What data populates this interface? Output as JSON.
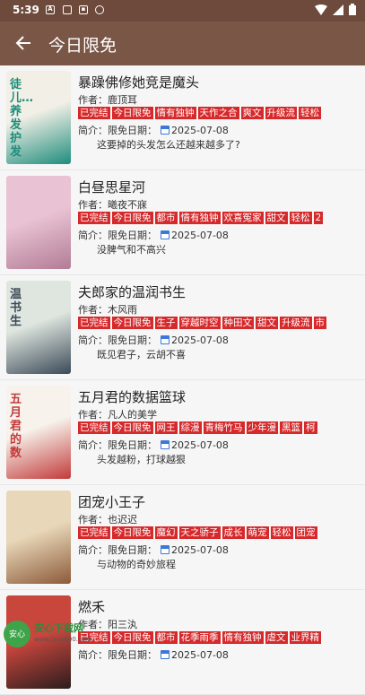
{
  "status_bar": {
    "time": "5:39"
  },
  "app_bar": {
    "title": "今日限免"
  },
  "labels": {
    "author_prefix": "作者：",
    "intro_prefix": "简介：",
    "date_prefix": "限免日期："
  },
  "books": [
    {
      "title": "暴躁佛修她竞是魔头",
      "author": "鹿顶耳",
      "tags": [
        "已完结",
        "今日限免",
        "情有独钟",
        "天作之合",
        "爽文",
        "升级流",
        "轻松"
      ],
      "date": "2025-07-08",
      "summary": "这要掉的头发怎么还越来越多了?",
      "cover_colors": [
        "#f2efe6",
        "#1e8d7c"
      ],
      "cover_text": "徒儿…养发护发"
    },
    {
      "title": "白昼思星河",
      "author": "曦夜不寐",
      "tags": [
        "已完结",
        "今日限免",
        "都市",
        "情有独钟",
        "欢喜冤家",
        "甜文",
        "轻松",
        "2"
      ],
      "date": "2025-07-08",
      "summary": "没脾气和不高兴",
      "cover_colors": [
        "#e9c3d3",
        "#b27c96"
      ],
      "cover_text": ""
    },
    {
      "title": "夫郎家的温润书生",
      "author": "木风雨",
      "tags": [
        "已完结",
        "今日限免",
        "生子",
        "穿越时空",
        "种田文",
        "甜文",
        "升级流",
        "市"
      ],
      "date": "2025-07-08",
      "summary": "既见君子，云胡不喜",
      "cover_colors": [
        "#dfe6df",
        "#3b4a58"
      ],
      "cover_text": "温书生"
    },
    {
      "title": "五月君的数据篮球",
      "author": "凡人的美学",
      "tags": [
        "已完结",
        "今日限免",
        "网王",
        "综漫",
        "青梅竹马",
        "少年漫",
        "黑篮",
        "柯"
      ],
      "date": "2025-07-08",
      "summary": "头发越粉，打球越狠",
      "cover_colors": [
        "#f7f3ec",
        "#c23b3b"
      ],
      "cover_text": "五月君的数"
    },
    {
      "title": "团宠小王子",
      "author": "也迟迟",
      "tags": [
        "已完结",
        "今日限免",
        "魔幻",
        "天之骄子",
        "成长",
        "萌宠",
        "轻松",
        "团宠"
      ],
      "date": "2025-07-08",
      "summary": "与动物的奇妙旅程",
      "cover_colors": [
        "#e8d7b8",
        "#8c5a3a"
      ],
      "cover_text": ""
    },
    {
      "title": "燃禾",
      "author": "阳三汍",
      "tags": [
        "已完结",
        "今日限免",
        "都市",
        "花季雨季",
        "情有独钟",
        "虐文",
        "业界精"
      ],
      "date": "2025-07-08",
      "summary": "",
      "cover_colors": [
        "#c9463d",
        "#2a1d1d"
      ],
      "cover_text": ""
    }
  ],
  "watermark": {
    "line1": "安心下载网",
    "line2": "www.java800.com",
    "logo": "安心"
  }
}
